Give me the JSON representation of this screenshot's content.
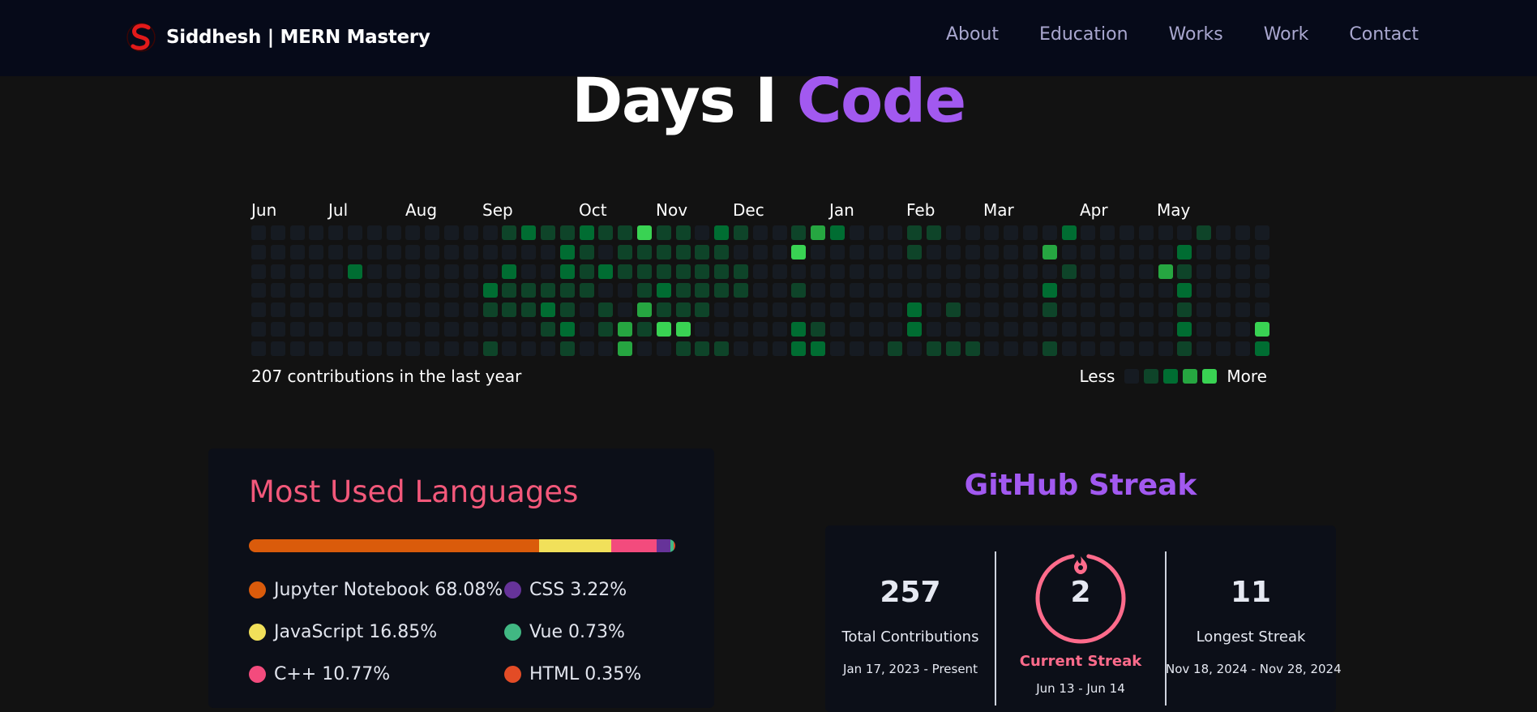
{
  "nav": {
    "brand": "Siddhesh  | MERN Mastery",
    "links": [
      "About",
      "Education",
      "Works",
      "Work",
      "Contact"
    ]
  },
  "title": {
    "part1": "Days I ",
    "part2": "Code"
  },
  "calendar": {
    "months": [
      "Jun",
      "Jul",
      "Aug",
      "Sep",
      "Oct",
      "Nov",
      "Dec",
      "Jan",
      "Feb",
      "Mar",
      "Apr",
      "May"
    ],
    "summary": "207 contributions in the last year",
    "legend_less": "Less",
    "legend_more": "More",
    "level_colors": [
      "#161b22",
      "#0e4429",
      "#006d32",
      "#26a641",
      "#39d353"
    ],
    "weeks": [
      [
        0,
        0,
        0,
        0,
        0,
        0,
        0
      ],
      [
        0,
        0,
        0,
        0,
        0,
        0,
        0
      ],
      [
        0,
        0,
        0,
        0,
        0,
        0,
        0
      ],
      [
        0,
        0,
        0,
        0,
        0,
        0,
        0
      ],
      [
        0,
        0,
        0,
        0,
        0,
        0,
        0
      ],
      [
        0,
        0,
        2,
        0,
        0,
        0,
        0
      ],
      [
        0,
        0,
        0,
        0,
        0,
        0,
        0
      ],
      [
        0,
        0,
        0,
        0,
        0,
        0,
        0
      ],
      [
        0,
        0,
        0,
        0,
        0,
        0,
        0
      ],
      [
        0,
        0,
        0,
        0,
        0,
        0,
        0
      ],
      [
        0,
        0,
        0,
        0,
        0,
        0,
        0
      ],
      [
        0,
        0,
        0,
        0,
        0,
        0,
        0
      ],
      [
        0,
        0,
        0,
        2,
        1,
        0,
        1
      ],
      [
        1,
        0,
        2,
        1,
        1,
        0,
        0
      ],
      [
        2,
        0,
        0,
        1,
        1,
        0,
        0
      ],
      [
        1,
        0,
        0,
        1,
        2,
        1,
        0
      ],
      [
        1,
        2,
        2,
        1,
        1,
        2,
        1
      ],
      [
        2,
        1,
        1,
        1,
        0,
        0,
        0
      ],
      [
        1,
        0,
        2,
        0,
        1,
        1,
        0
      ],
      [
        1,
        1,
        1,
        0,
        0,
        3,
        3
      ],
      [
        4,
        1,
        1,
        1,
        3,
        1,
        0
      ],
      [
        1,
        1,
        1,
        2,
        1,
        4,
        0
      ],
      [
        1,
        1,
        1,
        1,
        1,
        4,
        1
      ],
      [
        0,
        1,
        1,
        1,
        1,
        0,
        1
      ],
      [
        2,
        1,
        1,
        1,
        0,
        0,
        1
      ],
      [
        1,
        0,
        1,
        1,
        0,
        0,
        0
      ],
      [
        0,
        0,
        0,
        0,
        0,
        0,
        0
      ],
      [
        0,
        0,
        0,
        0,
        0,
        0,
        0
      ],
      [
        1,
        4,
        0,
        1,
        0,
        2,
        2
      ],
      [
        3,
        0,
        0,
        0,
        0,
        1,
        2
      ],
      [
        2,
        0,
        0,
        0,
        0,
        0,
        0
      ],
      [
        0,
        0,
        0,
        0,
        0,
        0,
        0
      ],
      [
        0,
        0,
        0,
        0,
        0,
        0,
        0
      ],
      [
        0,
        0,
        0,
        0,
        0,
        0,
        1
      ],
      [
        1,
        1,
        0,
        0,
        2,
        2,
        0
      ],
      [
        1,
        0,
        0,
        0,
        0,
        0,
        1
      ],
      [
        0,
        0,
        0,
        0,
        1,
        0,
        1
      ],
      [
        0,
        0,
        0,
        0,
        0,
        0,
        1
      ],
      [
        0,
        0,
        0,
        0,
        0,
        0,
        0
      ],
      [
        0,
        0,
        0,
        0,
        0,
        0,
        0
      ],
      [
        0,
        0,
        0,
        0,
        0,
        0,
        0
      ],
      [
        0,
        3,
        0,
        2,
        1,
        0,
        1
      ],
      [
        2,
        0,
        1,
        0,
        0,
        0,
        0
      ],
      [
        0,
        0,
        0,
        0,
        0,
        0,
        0
      ],
      [
        0,
        0,
        0,
        0,
        0,
        0,
        0
      ],
      [
        0,
        0,
        0,
        0,
        0,
        0,
        0
      ],
      [
        0,
        0,
        0,
        0,
        0,
        0,
        0
      ],
      [
        0,
        0,
        3,
        0,
        0,
        0,
        0
      ],
      [
        0,
        2,
        1,
        2,
        1,
        2,
        1
      ],
      [
        1,
        0,
        0,
        0,
        0,
        0,
        0
      ],
      [
        0,
        0,
        0,
        0,
        0,
        0,
        0
      ],
      [
        0,
        0,
        0,
        0,
        0,
        0,
        0
      ],
      [
        0,
        0,
        0,
        0,
        0,
        4,
        2
      ]
    ]
  },
  "languages": {
    "title": "Most Used Languages",
    "items": [
      {
        "name": "Jupyter Notebook",
        "percent": "68.08%",
        "value": 68.08,
        "color": "#DA5B0B"
      },
      {
        "name": "CSS",
        "percent": "3.22%",
        "value": 3.22,
        "color": "#663399"
      },
      {
        "name": "JavaScript",
        "percent": "16.85%",
        "value": 16.85,
        "color": "#F1E05A"
      },
      {
        "name": "Vue",
        "percent": "0.73%",
        "value": 0.73,
        "color": "#41B883"
      },
      {
        "name": "C++",
        "percent": "10.77%",
        "value": 10.77,
        "color": "#F34B7D"
      },
      {
        "name": "HTML",
        "percent": "0.35%",
        "value": 0.35,
        "color": "#E34C26"
      }
    ]
  },
  "streak": {
    "heading": "GitHub Streak",
    "total": {
      "value": "257",
      "label": "Total Contributions",
      "range": "Jan 17, 2023 - Present"
    },
    "current": {
      "value": "2",
      "label": "Current Streak",
      "range": "Jun 13 - Jun 14"
    },
    "longest": {
      "value": "11",
      "label": "Longest Streak",
      "range": "Nov 18, 2024 - Nov 28, 2024"
    }
  }
}
